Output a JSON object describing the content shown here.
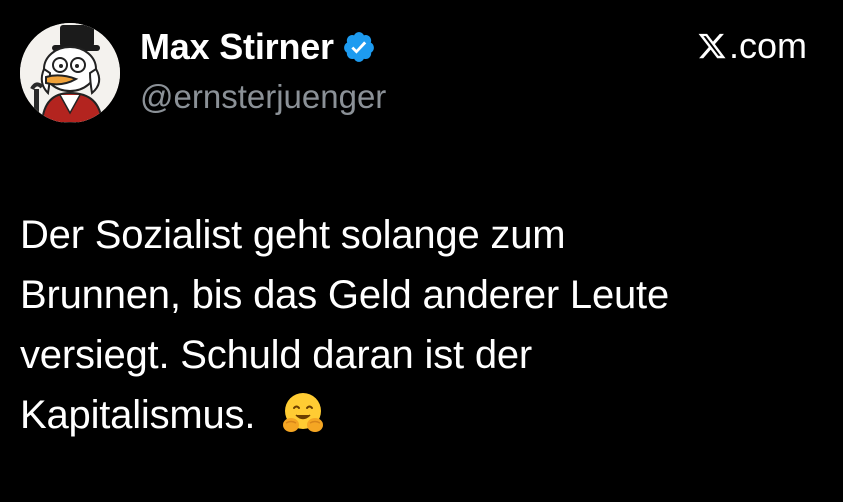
{
  "author": {
    "display_name": "Max Stirner",
    "handle": "@ernsterjuenger",
    "verified": true,
    "avatar_icon": "scrooge-mcduck-avatar-icon"
  },
  "brand": {
    "icon": "x-logo-icon",
    "domain": ".com"
  },
  "tweet": {
    "lines": [
      "Der Sozialist geht solange zum",
      "Brunnen, bis das Geld anderer Leute",
      "versiegt. Schuld daran ist der",
      "Kapitalismus."
    ],
    "emoji": "hugging-face-emoji"
  },
  "colors": {
    "background": "#000000",
    "text_primary": "#ffffff",
    "text_secondary": "#8b9197",
    "verified_blue": "#1d9bf0"
  }
}
